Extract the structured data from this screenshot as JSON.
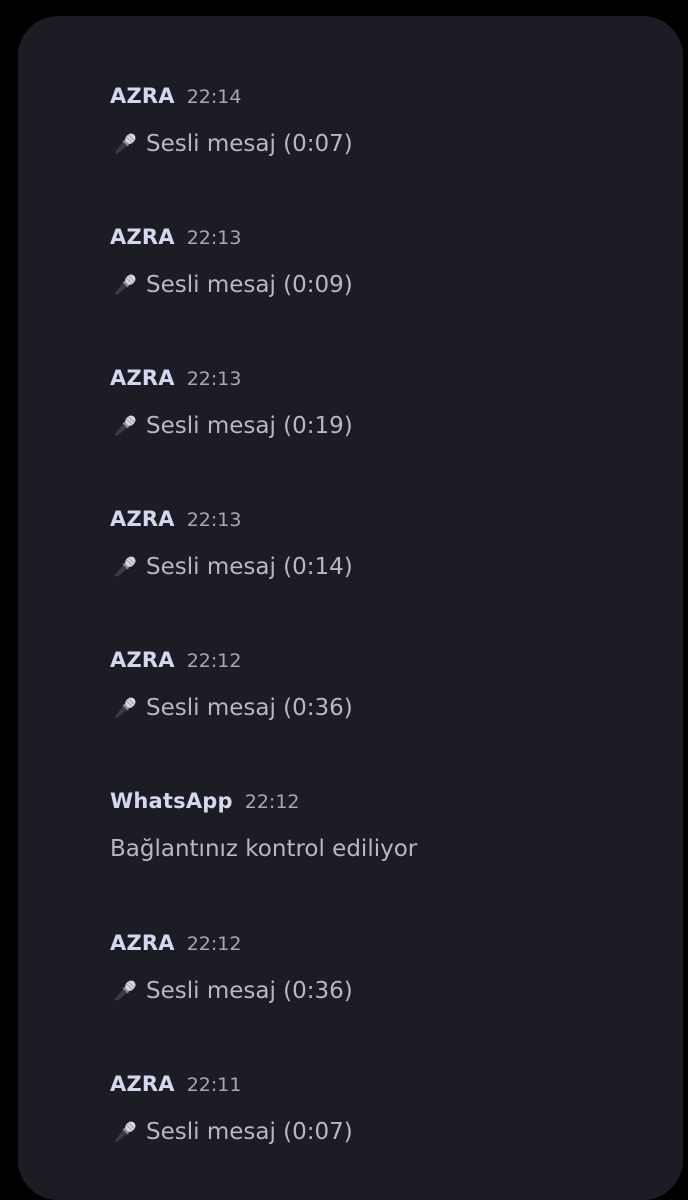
{
  "messages": [
    {
      "sender": "AZRA",
      "time": "22:14",
      "type": "voice",
      "text": "Sesli mesaj (0:07)",
      "icon": "microphone-icon"
    },
    {
      "sender": "AZRA",
      "time": "22:13",
      "type": "voice",
      "text": "Sesli mesaj (0:09)",
      "icon": "microphone-icon"
    },
    {
      "sender": "AZRA",
      "time": "22:13",
      "type": "voice",
      "text": "Sesli mesaj (0:19)",
      "icon": "microphone-icon"
    },
    {
      "sender": "AZRA",
      "time": "22:13",
      "type": "voice",
      "text": "Sesli mesaj (0:14)",
      "icon": "microphone-icon"
    },
    {
      "sender": "AZRA",
      "time": "22:12",
      "type": "voice",
      "text": "Sesli mesaj (0:36)",
      "icon": "microphone-icon"
    },
    {
      "sender": "WhatsApp",
      "time": "22:12",
      "type": "text",
      "text": "Bağlantınız kontrol ediliyor"
    },
    {
      "sender": "AZRA",
      "time": "22:12",
      "type": "voice",
      "text": "Sesli mesaj (0:36)",
      "icon": "microphone-icon"
    },
    {
      "sender": "AZRA",
      "time": "22:11",
      "type": "voice",
      "text": "Sesli mesaj (0:07)",
      "icon": "microphone-icon"
    }
  ],
  "colors": {
    "background": "#000000",
    "panel": "#1c1c24",
    "sender": "#d6d6ee",
    "time": "#a8a8b4",
    "body_text": "#b8b8c0"
  }
}
